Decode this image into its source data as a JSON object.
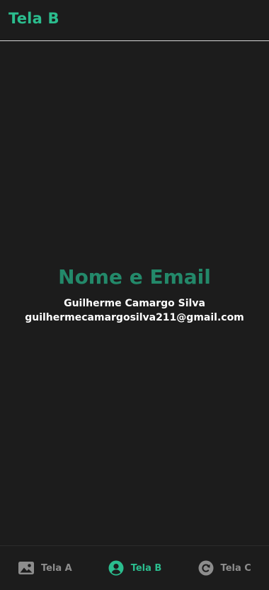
{
  "header": {
    "title": "Tela B"
  },
  "main": {
    "heading": "Nome e Email",
    "name": "Guilherme Camargo Silva",
    "email": "guilhermecamargosilva211@gmail.com"
  },
  "tabbar": {
    "active_index": 1,
    "tabs": [
      {
        "label": "Tela A",
        "icon": "image-icon"
      },
      {
        "label": "Tela B",
        "icon": "person-circle-icon"
      },
      {
        "label": "Tela C",
        "icon": "refresh-icon"
      }
    ]
  },
  "colors": {
    "background": "#1c1c1c",
    "accent": "#2bbd8e",
    "heading": "#23896a",
    "inactive": "#8d8d8d",
    "text": "#ffffff"
  }
}
